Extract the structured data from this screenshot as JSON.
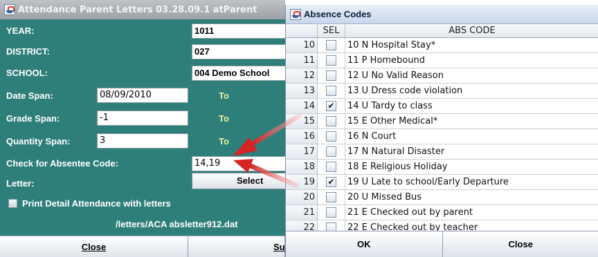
{
  "left_window": {
    "title": "Attendance Parent Letters   03.28.09.1 atParent",
    "labels": {
      "year": "YEAR:",
      "district": "DISTRICT:",
      "school": "SCHOOL:",
      "date_span": "Date Span:",
      "grade_span": "Grade Span:",
      "quantity_span": "Quantity Span:",
      "check_absentee": "Check for Absentee Code:",
      "letter": "Letter:"
    },
    "values": {
      "year": "1011",
      "district": "027",
      "school": "004 Demo School",
      "date_from": "08/09/2010",
      "grade_from": "-1",
      "quantity_from": "3",
      "absentee_codes": "14,19"
    },
    "to_label": "To",
    "select_button": "Select",
    "print_detail_label": "Print Detail Attendance with letters",
    "letter_path": "/letters/ACA absletter912.dat",
    "close_button": "Close",
    "submit_button": "Submit"
  },
  "absence_dialog": {
    "title": "Absence Codes",
    "columns": {
      "num": "",
      "sel": "SEL",
      "code": "ABS CODE"
    },
    "rows": [
      {
        "num": "10",
        "selected": false,
        "code": "10 N Hospital Stay*"
      },
      {
        "num": "11",
        "selected": false,
        "code": "11 P Homebound"
      },
      {
        "num": "12",
        "selected": false,
        "code": "12 U No Valid Reason"
      },
      {
        "num": "13",
        "selected": false,
        "code": "13 U Dress code violation"
      },
      {
        "num": "14",
        "selected": true,
        "code": "14 U Tardy to class"
      },
      {
        "num": "15",
        "selected": false,
        "code": "15 E Other Medical*"
      },
      {
        "num": "16",
        "selected": false,
        "code": "16 N Court"
      },
      {
        "num": "17",
        "selected": false,
        "code": "17 N Natural Disaster"
      },
      {
        "num": "18",
        "selected": false,
        "code": "18 E Religious Holiday"
      },
      {
        "num": "19",
        "selected": true,
        "code": "19 U Late to school/Early Departure"
      },
      {
        "num": "20",
        "selected": false,
        "code": "20 U Missed Bus"
      },
      {
        "num": "21",
        "selected": false,
        "code": "21 E Checked out by parent"
      },
      {
        "num": "22",
        "selected": false,
        "code": "22 E Checked out by teacher"
      }
    ],
    "ok_button": "OK",
    "close_button": "Close",
    "check_glyph": "✔"
  },
  "colors": {
    "window_bg": "#2e7f7a",
    "label_text": "#ffffff",
    "to_text": "#e8f0a0",
    "arrow": "#d42424"
  }
}
